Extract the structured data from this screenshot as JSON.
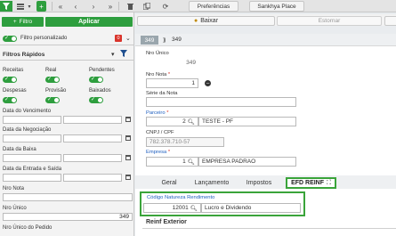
{
  "toolbar": {
    "preferences_label": "Preferências",
    "place_label": "Sankhya Place"
  },
  "left": {
    "filtro_label": "Filtro",
    "aplicar_label": "Aplicar",
    "filtro_personalizado_label": "Filtro personalizado",
    "filtro_personalizado_count": "0",
    "filtros_rapidos_title": "Filtros Rápidos",
    "quick": {
      "receitas": "Receitas",
      "real": "Real",
      "pendentes": "Pendentes",
      "despesas": "Despesas",
      "provisao": "Provisão",
      "baixados": "Baixados"
    },
    "fields": {
      "data_vencimento": "Data do Vencimento",
      "data_negociacao": "Data da Negociação",
      "data_baixa": "Data da Baixa",
      "data_entrada_saida": "Data da Entrada e Saída",
      "nro_nota": "Nro Nota",
      "nro_unico": "Nro Único",
      "nro_unico_value": "349",
      "nro_unico_pedido": "Nro Único do Pedido"
    }
  },
  "actions": {
    "baixar_label": "Baixar",
    "estornar_label": "Estornar"
  },
  "record": {
    "index": "349",
    "nav_number": "349",
    "nro_unico_label": "Nro Único",
    "nro_unico_value": "349",
    "nro_nota_label": "Nro Nota",
    "nro_nota_value": "1",
    "serie_label": "Série da Nota",
    "parceiro_label": "Parceiro",
    "parceiro_code": "2",
    "parceiro_name": "TESTE - PF",
    "cnpj_label": "CNPJ / CPF",
    "cnpj_value": "782.378.710-57",
    "empresa_label": "Empresa",
    "empresa_code": "1",
    "empresa_name": "EMPRESA PADRAO"
  },
  "tabs": [
    {
      "label": "Geral"
    },
    {
      "label": "Lançamento"
    },
    {
      "label": "Impostos"
    },
    {
      "label": "EFD REINF"
    }
  ],
  "reinf": {
    "codigo_label": "Código Natureza Rendimento",
    "codigo_value": "12001",
    "codigo_desc": "Lucro e Dividendo",
    "section_title": "Reinf Exterior"
  },
  "colors": {
    "accent_green": "#2e9e3e",
    "highlight_green": "#3aa43a",
    "link_blue": "#1f5fbf",
    "badge_red": "#d9342b"
  }
}
